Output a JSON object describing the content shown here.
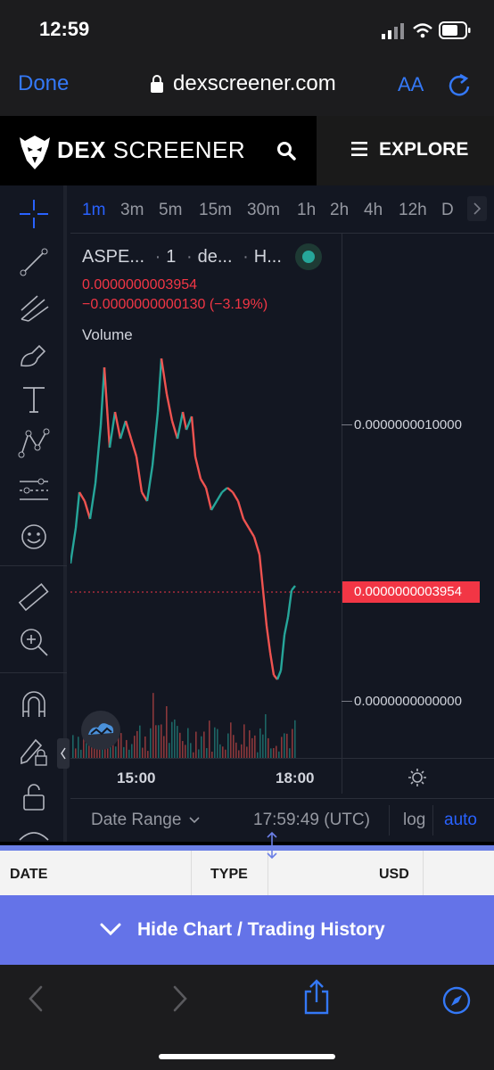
{
  "status_bar": {
    "time": "12:59"
  },
  "browser": {
    "done_label": "Done",
    "url": "dexscreener.com",
    "aa_label": "AA"
  },
  "header": {
    "brand_bold": "DEX",
    "brand_light": "SCREENER",
    "explore_label": "EXPLORE"
  },
  "chart": {
    "timeframes": [
      "1m",
      "3m",
      "5m",
      "15m",
      "30m",
      "1h",
      "2h",
      "4h",
      "12h",
      "D"
    ],
    "active_timeframe": "1m",
    "legend": {
      "symbol": "ASPE...",
      "interval": "1",
      "exchange": "de...",
      "extra": "H..."
    },
    "price": "0.0000000003954",
    "change": "−0.0000000000130 (−3.19%)",
    "volume_label": "Volume",
    "axis_labels": [
      "0.0000000010000",
      "0.0000000000000"
    ],
    "current_price_tag": "0.0000000003954",
    "time_labels": [
      "15:00",
      "18:00"
    ],
    "date_range_label": "Date Range",
    "clock": "17:59:49 (UTC)",
    "log_label": "log",
    "auto_label": "auto",
    "colors": {
      "up": "#26a69a",
      "down": "#ef5350"
    }
  },
  "trading_history": {
    "columns": [
      "DATE",
      "TYPE",
      "USD"
    ],
    "hide_button": "Hide Chart / Trading History"
  }
}
